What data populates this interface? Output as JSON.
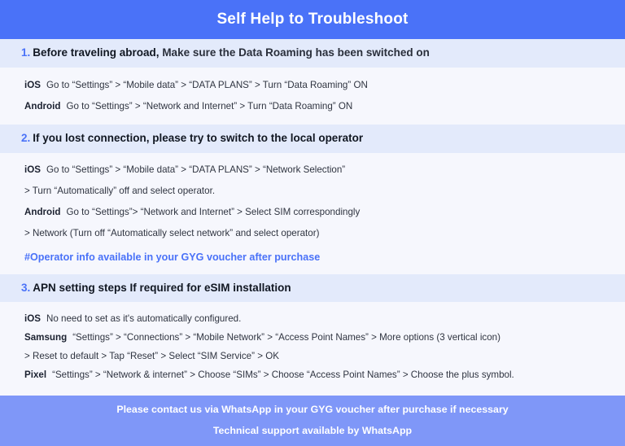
{
  "header": {
    "title": "Self Help to Troubleshoot",
    "bg_color": "#4a72f8",
    "text_color": "#ffffff"
  },
  "colors": {
    "accent": "#4a72f8",
    "section_head_bg": "#e3eafb",
    "section_body_bg": "#f6f7fd",
    "footer_bg": "#7f97f8",
    "body_text": "#2f3440"
  },
  "sections": [
    {
      "number": "1.",
      "title_lead": "Before traveling abroad,",
      "title_rest": " Make sure the Data Roaming has been switched on",
      "lines": [
        {
          "platform": "iOS",
          "text": "Go to “Settings” > “Mobile data” > “DATA PLANS” > Turn “Data Roaming” ON"
        },
        {
          "platform": "Android",
          "text": "Go to “Settings” > “Network and Internet” > Turn “Data Roaming” ON"
        }
      ],
      "note": ""
    },
    {
      "number": "2.",
      "title_lead": "If you lost connection, please try to switch to the local operator",
      "title_rest": "",
      "lines": [
        {
          "platform": "iOS",
          "text": "Go to “Settings” > “Mobile data” > “DATA PLANS” > “Network Selection”"
        },
        {
          "platform": "",
          "text": "> Turn “Automatically” off and select operator."
        },
        {
          "platform": "Android",
          "text": "Go to “Settings”>  “Network and Internet” > Select SIM correspondingly"
        },
        {
          "platform": "",
          "text": "> Network (Turn off “Automatically select network” and select operator)"
        }
      ],
      "note": "#Operator info available in your GYG voucher after purchase"
    },
    {
      "number": "3.",
      "title_lead": "APN setting steps If required for eSIM installation",
      "title_rest": "",
      "lines": [
        {
          "platform": "iOS",
          "text": "No need to set as it's automatically configured."
        },
        {
          "platform": "Samsung",
          "text": "“Settings” > “Connections” > “Mobile Network” > “Access Point Names” > More options (3 vertical icon)"
        },
        {
          "platform": "",
          "text": "> Reset to default > Tap “Reset” > Select “SIM Service” > OK"
        },
        {
          "platform": "Pixel",
          "text": "“Settings” > “Network & internet” > Choose “SIMs” > Choose “Access Point Names” > Choose the plus symbol."
        }
      ],
      "note": ""
    }
  ],
  "footer": {
    "line1": "Please contact us via WhatsApp  in your GYG voucher after purchase if necessary",
    "line2": "Technical support available by WhatsApp"
  }
}
